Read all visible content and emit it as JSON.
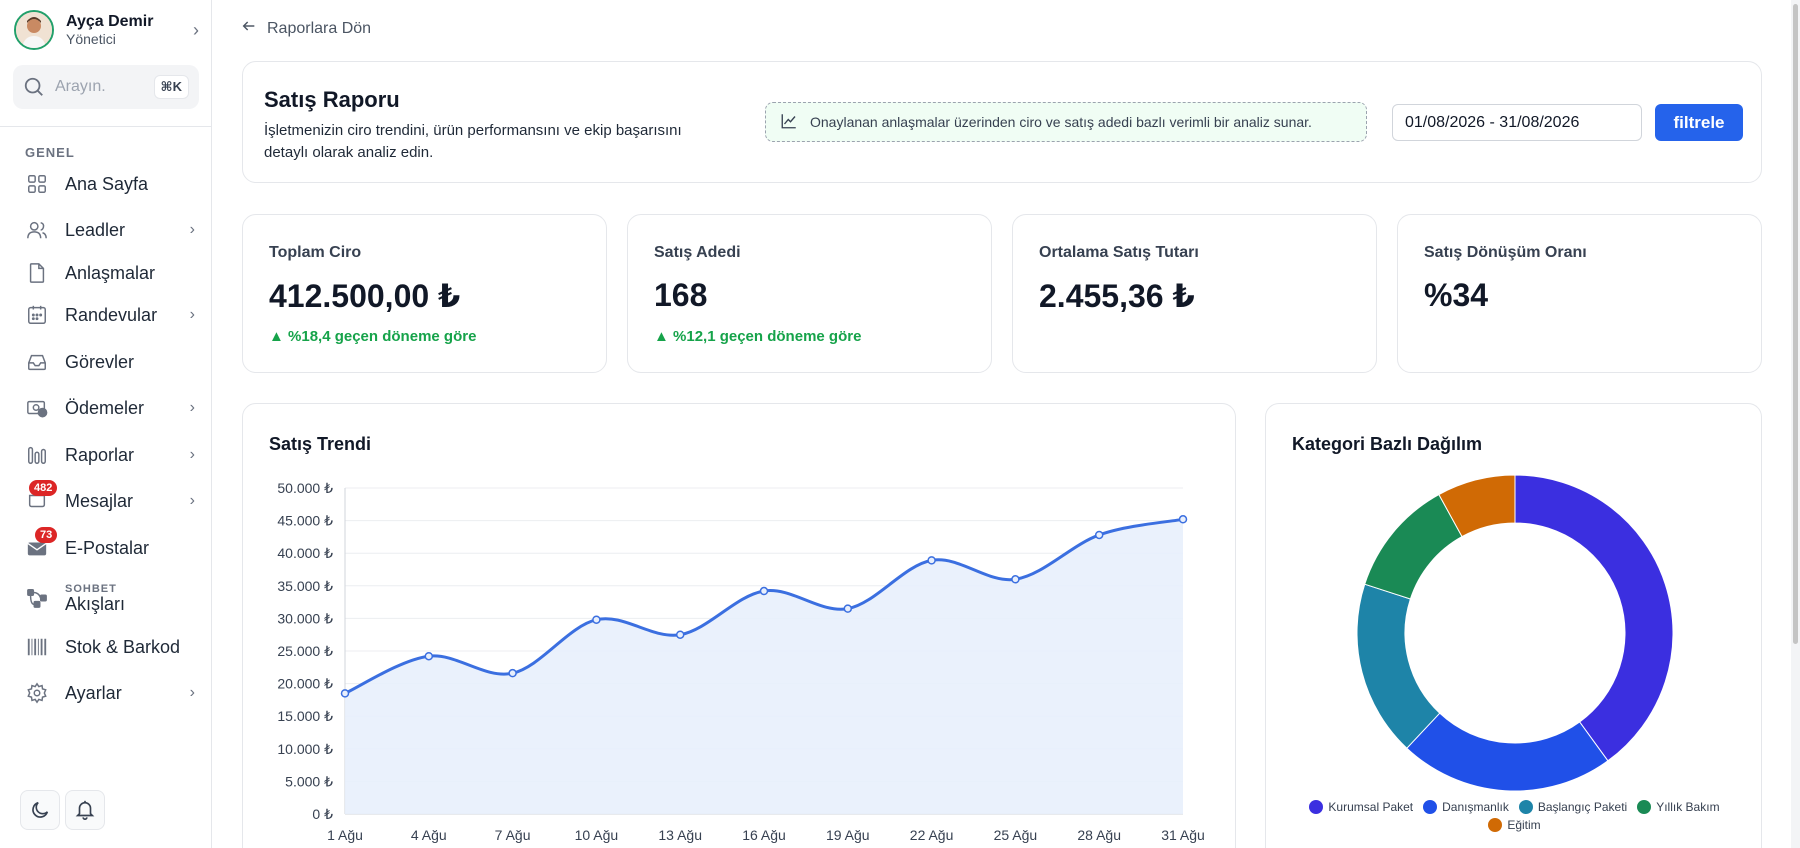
{
  "user": {
    "name": "Ayça Demir",
    "role": "Yönetici"
  },
  "search": {
    "placeholder": "Arayın.",
    "shortcut": "⌘K"
  },
  "sidebar": {
    "section": "GENEL",
    "items": [
      {
        "label": "Ana Sayfa",
        "icon": "grid-icon",
        "chevron": false
      },
      {
        "label": "Leadler",
        "icon": "users-icon",
        "chevron": true
      },
      {
        "label": "Anlaşmalar",
        "icon": "file-icon",
        "chevron": false
      },
      {
        "label": "Randevular",
        "icon": "calendar-icon",
        "chevron": true
      },
      {
        "label": "Görevler",
        "icon": "inbox-icon",
        "chevron": false
      },
      {
        "label": "Ödemeler",
        "icon": "money-icon",
        "chevron": true
      },
      {
        "label": "Raporlar",
        "icon": "bar-chart-icon",
        "chevron": true
      },
      {
        "label": "Mesajlar",
        "icon": "message-icon",
        "chevron": true,
        "badge": "482"
      },
      {
        "label": "E-Postalar",
        "icon": "mail-icon",
        "chevron": false,
        "badge": "73"
      },
      {
        "label": "Akışları",
        "icon": "flow-icon",
        "chevron": false,
        "sublabel": "SOHBET"
      },
      {
        "label": "Stok & Barkod",
        "icon": "barcode-icon",
        "chevron": false
      },
      {
        "label": "Ayarlar",
        "icon": "gear-icon",
        "chevron": true
      }
    ]
  },
  "back": {
    "label": "Raporlara Dön"
  },
  "header": {
    "title": "Satış Raporu",
    "description": "İşletmenizin ciro trendini, ürün performansını ve ekip başarısını detaylı olarak analiz edin.",
    "info": "Onaylanan anlaşmalar üzerinden ciro ve satış adedi bazlı verimli bir analiz sunar.",
    "date_range": "01/08/2026 - 31/08/2026",
    "filter_label": "filtrele"
  },
  "kpis": [
    {
      "label": "Toplam Ciro",
      "value": "412.500,00 ₺",
      "change": "▲ %18,4 geçen döneme göre"
    },
    {
      "label": "Satış Adedi",
      "value": "168",
      "change": "▲ %12,1 geçen döneme göre"
    },
    {
      "label": "Ortalama Satış Tutarı",
      "value": "2.455,36 ₺",
      "change": ""
    },
    {
      "label": "Satış Dönüşüm Oranı",
      "value": "%34",
      "change": ""
    }
  ],
  "colors": {
    "accent": "#2563eb",
    "positive": "#16a34a",
    "line": "#3b6fe0",
    "area": "#e8effc"
  },
  "chart_data": [
    {
      "type": "area",
      "title": "Satış Trendi",
      "categories": [
        "1 Ağu",
        "4 Ağu",
        "7 Ağu",
        "10 Ağu",
        "13 Ağu",
        "16 Ağu",
        "19 Ağu",
        "22 Ağu",
        "25 Ağu",
        "28 Ağu",
        "31 Ağu"
      ],
      "values": [
        18500,
        24200,
        21600,
        29800,
        27500,
        34200,
        31500,
        38900,
        36000,
        42800,
        45200
      ],
      "ylim": [
        0,
        50000
      ],
      "yticks": [
        "0 ₺",
        "5.000 ₺",
        "10.000 ₺",
        "15.000 ₺",
        "20.000 ₺",
        "25.000 ₺",
        "30.000 ₺",
        "35.000 ₺",
        "40.000 ₺",
        "45.000 ₺",
        "50.000 ₺"
      ],
      "xlabel": "",
      "ylabel": "",
      "grid": true
    },
    {
      "type": "pie",
      "title": "Kategori Bazlı Dağılım",
      "labels": [
        "Kurumsal Paket",
        "Danışmanlık",
        "Başlangıç Paketi",
        "Yıllık Bakım",
        "Eğitim"
      ],
      "values": [
        40,
        22,
        18,
        12,
        8
      ],
      "colors": [
        "#3b2fe0",
        "#2050e8",
        "#1e84a8",
        "#1a8a55",
        "#d06a05"
      ],
      "legend": "bottom"
    }
  ]
}
